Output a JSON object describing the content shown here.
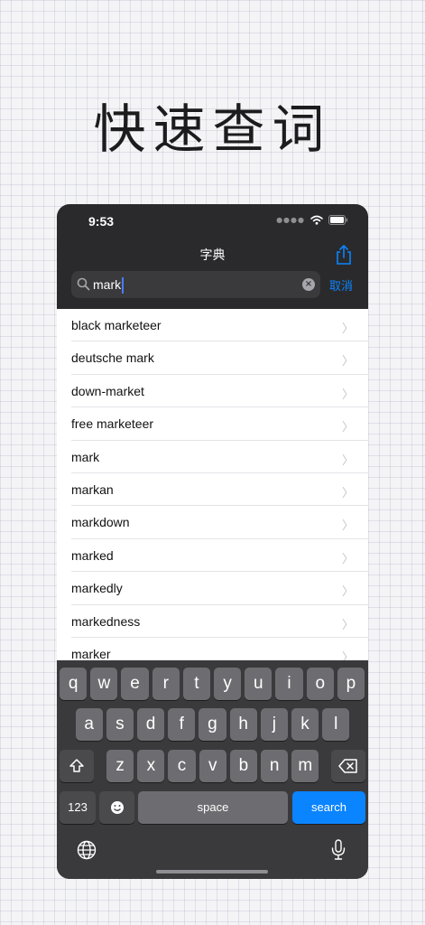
{
  "headline": "快速查词",
  "status_bar": {
    "time": "9:53"
  },
  "nav": {
    "title": "字典"
  },
  "search": {
    "query": "mark",
    "cancel_label": "取消"
  },
  "results": [
    "black marketeer",
    "deutsche mark",
    "down-market",
    "free marketeer",
    "mark",
    "markan",
    "markdown",
    "marked",
    "markedly",
    "markedness",
    "marker"
  ],
  "keyboard": {
    "row1": [
      "q",
      "w",
      "e",
      "r",
      "t",
      "y",
      "u",
      "i",
      "o",
      "p"
    ],
    "row2": [
      "a",
      "s",
      "d",
      "f",
      "g",
      "h",
      "j",
      "k",
      "l"
    ],
    "row3": [
      "z",
      "x",
      "c",
      "v",
      "b",
      "n",
      "m"
    ],
    "numbers_label": "123",
    "space_label": "space",
    "search_label": "search"
  },
  "colors": {
    "accent": "#0a84ff",
    "panel": "#2a2a2c",
    "key": "#6d6d71"
  },
  "icons": [
    "wifi-icon",
    "battery-icon",
    "share-icon",
    "search-icon",
    "clear-icon",
    "chevron-right-icon",
    "shift-icon",
    "backspace-icon",
    "emoji-icon",
    "globe-icon",
    "microphone-icon"
  ]
}
